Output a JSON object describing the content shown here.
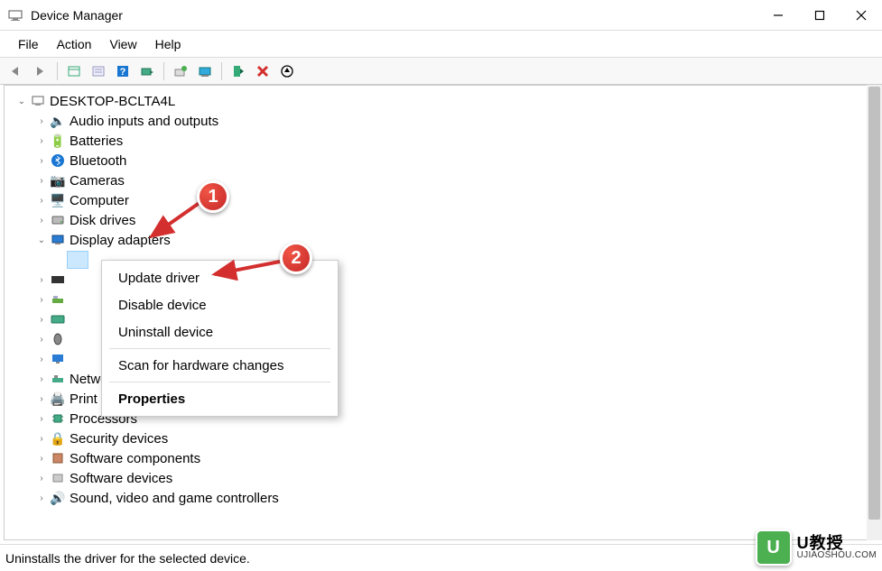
{
  "title": "Device Manager",
  "menubar": [
    "File",
    "Action",
    "View",
    "Help"
  ],
  "root": "DESKTOP-BCLTA4L",
  "nodes": [
    {
      "label": "Audio inputs and outputs",
      "icon": "speaker"
    },
    {
      "label": "Batteries",
      "icon": "battery"
    },
    {
      "label": "Bluetooth",
      "icon": "bluetooth"
    },
    {
      "label": "Cameras",
      "icon": "camera"
    },
    {
      "label": "Computer",
      "icon": "computer"
    },
    {
      "label": "Disk drives",
      "icon": "disk"
    },
    {
      "label": "Display adapters",
      "icon": "display",
      "expanded": true
    },
    {
      "label": "",
      "icon": "hid",
      "obscured": true
    },
    {
      "label": "",
      "icon": "ide",
      "obscured": true
    },
    {
      "label": "",
      "icon": "keyboard",
      "obscured": true
    },
    {
      "label": "",
      "icon": "mouse",
      "obscured": true
    },
    {
      "label": "",
      "icon": "monitor",
      "obscured": true
    },
    {
      "label": "Network adapters",
      "icon": "network"
    },
    {
      "label": "Print queues",
      "icon": "printer"
    },
    {
      "label": "Processors",
      "icon": "cpu"
    },
    {
      "label": "Security devices",
      "icon": "security"
    },
    {
      "label": "Software components",
      "icon": "swc"
    },
    {
      "label": "Software devices",
      "icon": "swd"
    },
    {
      "label": "Sound, video and game controllers",
      "icon": "sound"
    }
  ],
  "context": {
    "items": [
      "Update driver",
      "Disable device",
      "Uninstall device"
    ],
    "scan": "Scan for hardware changes",
    "properties": "Properties"
  },
  "status": "Uninstalls the driver for the selected device.",
  "callouts": {
    "c1": "1",
    "c2": "2"
  },
  "watermark": {
    "brand": "U教授",
    "url": "UJIAOSHOU.COM",
    "badge": "U"
  }
}
